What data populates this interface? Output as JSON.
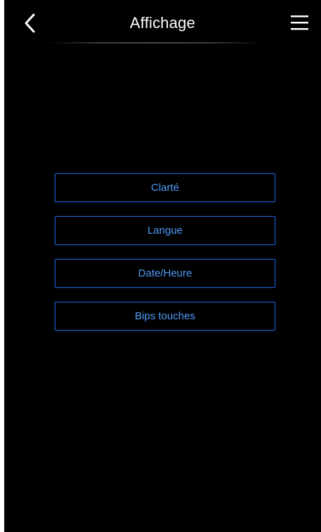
{
  "header": {
    "back_icon": "chevron-left-icon",
    "title": "Affichage",
    "menu_icon": "hamburger-menu-icon"
  },
  "menu": {
    "items": [
      {
        "label": "Clarté"
      },
      {
        "label": "Langue"
      },
      {
        "label": "Date/Heure"
      },
      {
        "label": "Bips touches"
      }
    ]
  },
  "colors": {
    "background": "#000000",
    "button_border": "#1f5fd6",
    "button_text": "#4f9bf5",
    "title_text": "#ffffff"
  }
}
